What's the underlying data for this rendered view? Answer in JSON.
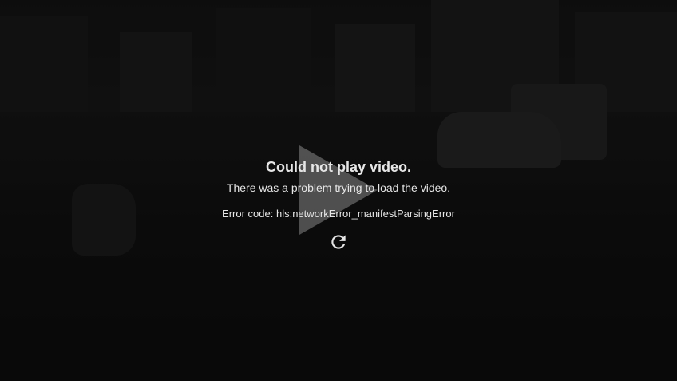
{
  "error": {
    "title": "Could not play video.",
    "description": "There was a problem trying to load the video.",
    "code": "Error code: hls:networkError_manifestParsingError"
  },
  "icons": {
    "play": "play-icon",
    "retry": "retry-icon"
  },
  "colors": {
    "text": "#e6e6e6",
    "overlay": "rgba(0,0,0,0.55)"
  }
}
